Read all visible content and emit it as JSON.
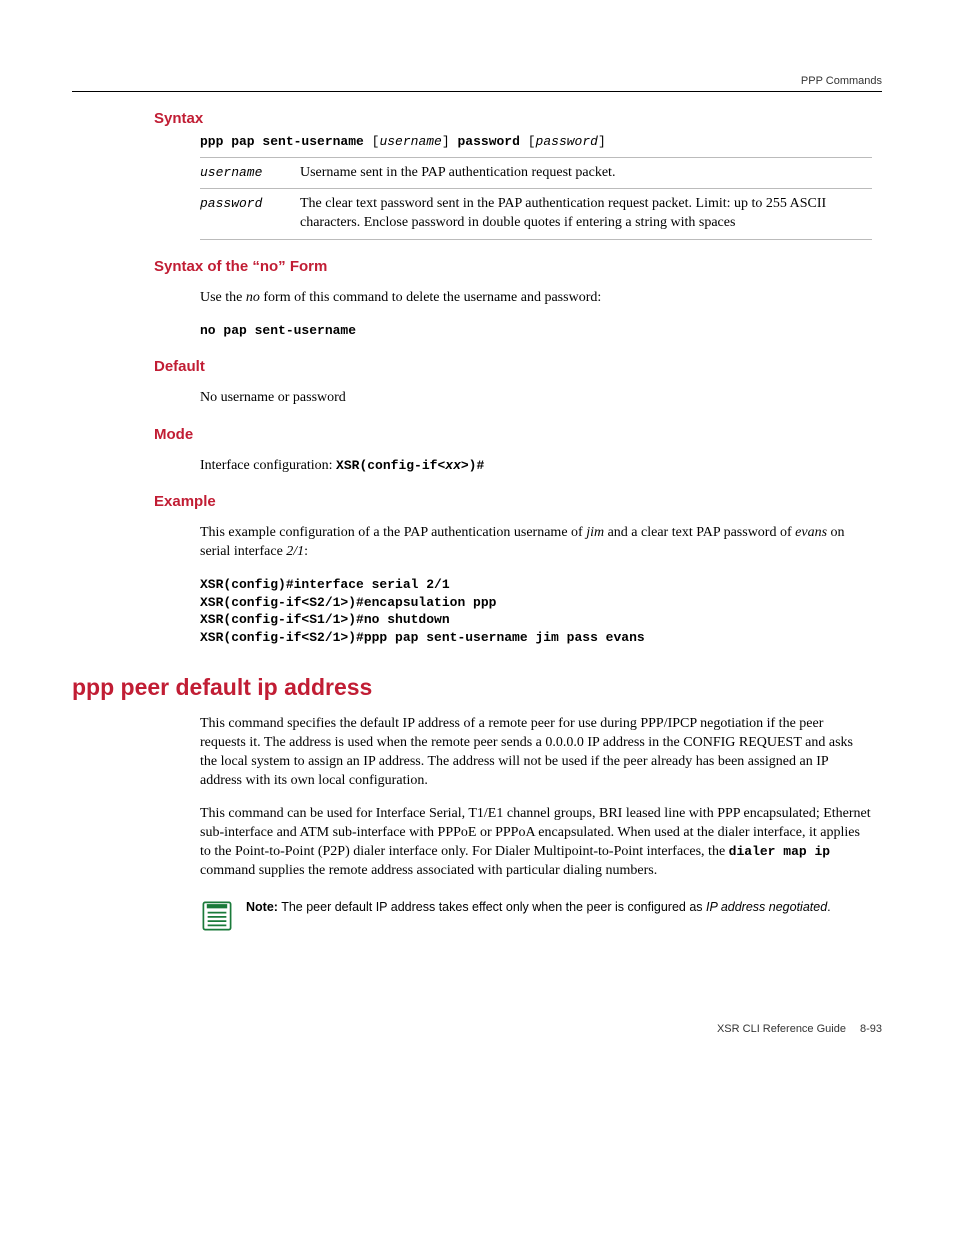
{
  "header": {
    "right": "PPP Commands"
  },
  "sections": {
    "syntax": {
      "heading": "Syntax",
      "line": {
        "p1": "ppp pap sent-username",
        "p2": "[",
        "p3": "username",
        "p4": "]",
        "p5": "password",
        "p6": "[",
        "p7": "password",
        "p8": "]"
      },
      "rows": [
        {
          "name": "username",
          "desc": "Username sent in the PAP authentication request packet."
        },
        {
          "name": "password",
          "desc": "The clear text password sent in the PAP authentication request packet. Limit: up to 255 ASCII characters. Enclose password in double quotes if entering a string with spaces"
        }
      ]
    },
    "noform": {
      "heading": "Syntax of the “no” Form",
      "text_pre": "Use the ",
      "text_ital": "no",
      "text_post": " form of this command to delete the username and password:",
      "cmd": "no pap sent-username"
    },
    "default": {
      "heading": "Default",
      "text": "No username or password"
    },
    "mode": {
      "heading": "Mode",
      "text_pre": "Interface configuration: ",
      "prompt1": "XSR(config-if<",
      "prompt_ital": "xx",
      "prompt2": ">)#"
    },
    "example": {
      "heading": "Example",
      "p_pre": "This example configuration of a the PAP authentication username of ",
      "p_i1": "jim",
      "p_mid": " and a clear text PAP password of ",
      "p_i2": "evans",
      "p_mid2": " on serial interface ",
      "p_i3": "2/1",
      "p_end": ":",
      "code": "XSR(config)#interface serial 2/1\nXSR(config-if<S2/1>)#encapsulation ppp\nXSR(config-if<S1/1>)#no shutdown\nXSR(config-if<S2/1>)#ppp pap sent-username jim pass evans"
    },
    "cmd2": {
      "heading": "ppp peer default ip address",
      "p1": "This command specifies the default IP address of a remote peer for use during PPP/IPCP negotiation if the peer requests it. The address is used when the remote peer sends a 0.0.0.0 IP address in the CONFIG REQUEST and asks the local system to assign an IP address. The address will not be used if the peer already has been assigned an IP address with its own local configuration.",
      "p2a": "This command can be used for Interface Serial, T1/E1 channel groups, BRI leased line with PPP encapsulated; Ethernet sub-interface and ATM sub-interface with PPPoE or PPPoA encapsulated. When used at the dialer interface, it applies to the Point-to-Point (P2P) dialer interface only. For Dialer Multipoint-to-Point interfaces, the ",
      "p2mono": "dialer map ip",
      "p2b": " command supplies the remote address associated with particular dialing numbers.",
      "note_b": "Note:",
      "note_t1": " The peer default IP address takes effect only when the peer is configured as ",
      "note_i": "IP address negotiated",
      "note_t2": "."
    }
  },
  "footer": {
    "guide": "XSR CLI Reference Guide",
    "page": "8-93"
  }
}
